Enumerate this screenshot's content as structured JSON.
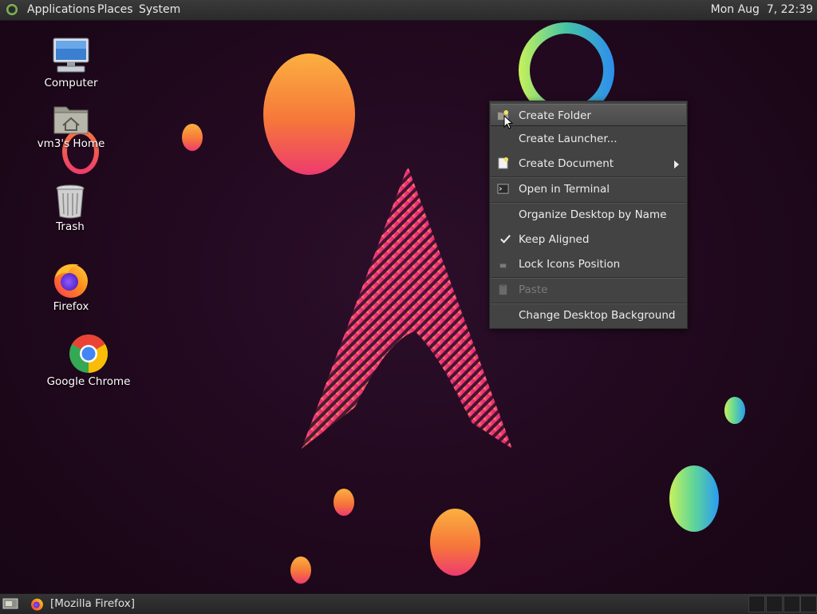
{
  "top_panel": {
    "menus": [
      {
        "label": "Applications"
      },
      {
        "label": "Places"
      },
      {
        "label": "System"
      }
    ],
    "clock": "Mon Aug  7, 22:39"
  },
  "desktop_icons": [
    {
      "label": "Computer",
      "icon": "computer-icon"
    },
    {
      "label": "vm3's Home",
      "icon": "home-folder-icon"
    },
    {
      "label": "Trash",
      "icon": "trash-icon"
    },
    {
      "label": "Firefox",
      "icon": "firefox-icon"
    },
    {
      "label": "Google Chrome",
      "icon": "chrome-icon"
    }
  ],
  "context_menu": {
    "items": [
      {
        "label": "Create Folder",
        "icon": "new-folder-icon",
        "highlighted": true
      },
      {
        "label": "Create Launcher..."
      },
      {
        "label": "Create Document",
        "icon": "new-document-icon",
        "submenu": true
      },
      {
        "label": "Open in Terminal",
        "icon": "terminal-icon"
      },
      {
        "label": "Organize Desktop by Name"
      },
      {
        "label": "Keep Aligned",
        "checked": true
      },
      {
        "label": "Lock Icons Position",
        "icon": "lock-icon"
      },
      {
        "label": "Paste",
        "icon": "paste-icon",
        "disabled": true
      },
      {
        "label": "Change Desktop Background"
      }
    ]
  },
  "bottom_panel": {
    "show_desktop_icon": "show-desktop-icon",
    "task": {
      "label": "[Mozilla Firefox]",
      "icon": "firefox-icon"
    }
  },
  "colors": {
    "background": "#22091f",
    "menu_bg": "#434343",
    "panel_bg": "#2b2b2b",
    "accent_pink": "#ee3b6e",
    "accent_orange": "#fbb040"
  }
}
